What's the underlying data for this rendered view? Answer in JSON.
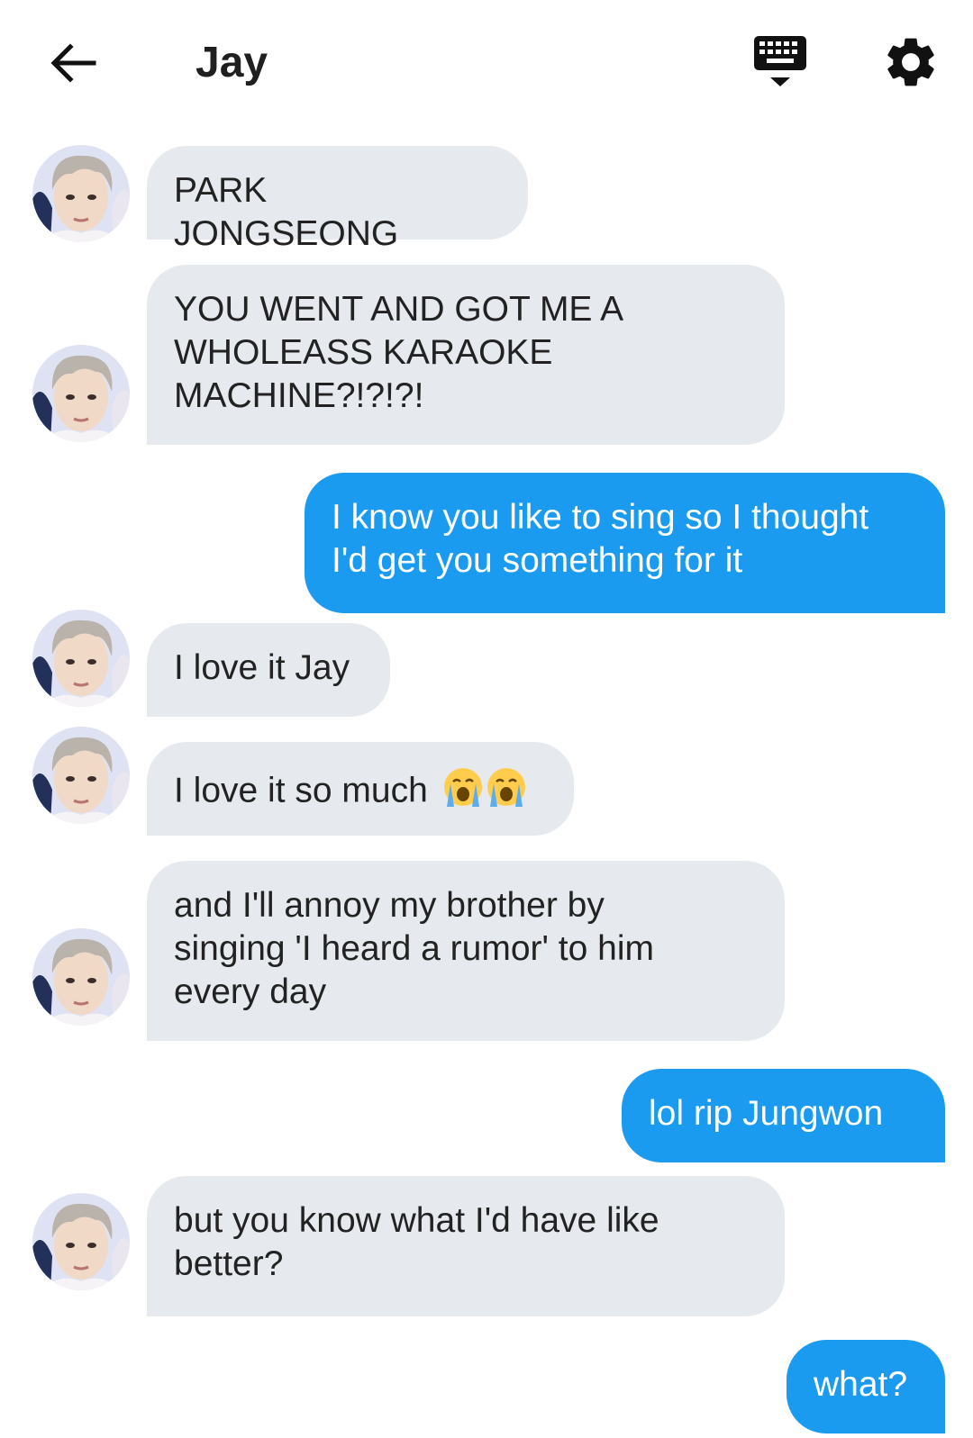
{
  "header": {
    "title": "Jay",
    "back_icon": "arrow-left-icon",
    "keyboard_icon": "keyboard-hide-icon",
    "settings_icon": "gear-icon"
  },
  "colors": {
    "incoming_bubble": "#e6eaee",
    "outgoing_bubble": "#1a9bf0",
    "outgoing_text": "#ffffff",
    "incoming_text": "#222222"
  },
  "messages": [
    {
      "sender": "contact",
      "text": "PARK JONGSEONG"
    },
    {
      "sender": "contact",
      "text": "YOU WENT AND GOT ME A\nWHOLEASS KARAOKE\nMACHINE?!?!?!"
    },
    {
      "sender": "me",
      "text": "I know you like to sing so I thought\nI'd get you something for it"
    },
    {
      "sender": "contact",
      "text": "I love it Jay"
    },
    {
      "sender": "contact",
      "text": "I love it so much",
      "emoji": "loudly-crying-face-icon x2"
    },
    {
      "sender": "contact",
      "text": "and I'll annoy my brother by\nsinging 'I heard a rumor' to him\nevery day"
    },
    {
      "sender": "me",
      "text": "lol rip Jungwon"
    },
    {
      "sender": "contact",
      "text": "but you know what I'd have like\nbetter?"
    },
    {
      "sender": "me",
      "text": "what?"
    }
  ]
}
